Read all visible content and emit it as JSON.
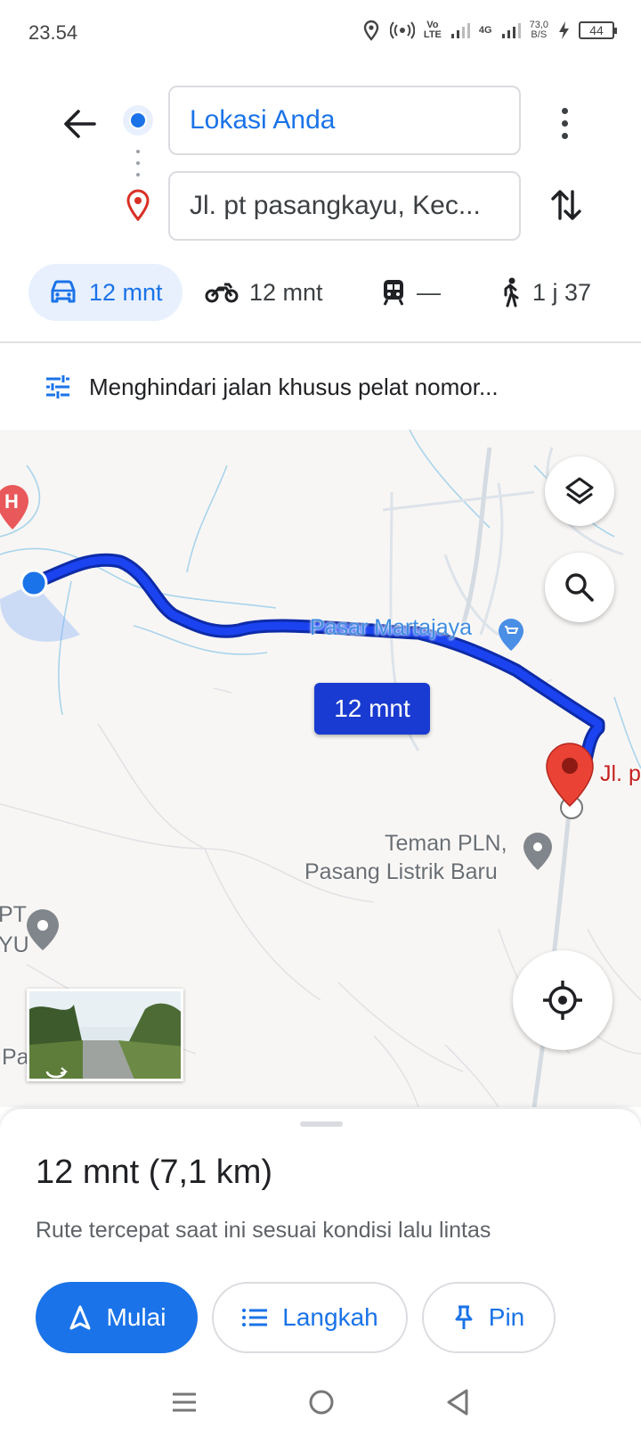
{
  "status_bar": {
    "time": "23.54",
    "network_speed": "73,0",
    "network_unit": "B/S",
    "battery": "44",
    "volte": "Vo",
    "volte_sub": "LTE",
    "net_type": "4G"
  },
  "directions": {
    "origin": "Lokasi Anda",
    "destination": "Jl. pt pasangkayu, Kec..."
  },
  "modes": [
    {
      "icon": "car-icon",
      "label": "12 mnt",
      "active": true
    },
    {
      "icon": "motorcycle-icon",
      "label": "12 mnt",
      "active": false
    },
    {
      "icon": "transit-icon",
      "label": "—",
      "active": false
    },
    {
      "icon": "walk-icon",
      "label": "1 j 37",
      "active": false
    }
  ],
  "options": {
    "label": "Menghindari jalan khusus pelat nomor..."
  },
  "map": {
    "route_chip": "12 mnt",
    "labels": {
      "market": "Pasar Martajaya",
      "pln_line1": "Teman PLN,",
      "pln_line2": "Pasang Listrik Baru",
      "dest_short": "Jl. p",
      "left_pt": "PT",
      "left_yu": "YU",
      "pasangkayu": "Pasangkayu",
      "hospital": "H"
    }
  },
  "sheet": {
    "summary": "12 mnt (7,1 km)",
    "subtitle": "Rute tercepat saat ini sesuai kondisi lalu lintas",
    "start_label": "Mulai",
    "steps_label": "Langkah",
    "pin_label": "Pin"
  },
  "colors": {
    "accent": "#1a73e8",
    "route": "#1a3bd1",
    "destination_pin": "#ea4335"
  }
}
